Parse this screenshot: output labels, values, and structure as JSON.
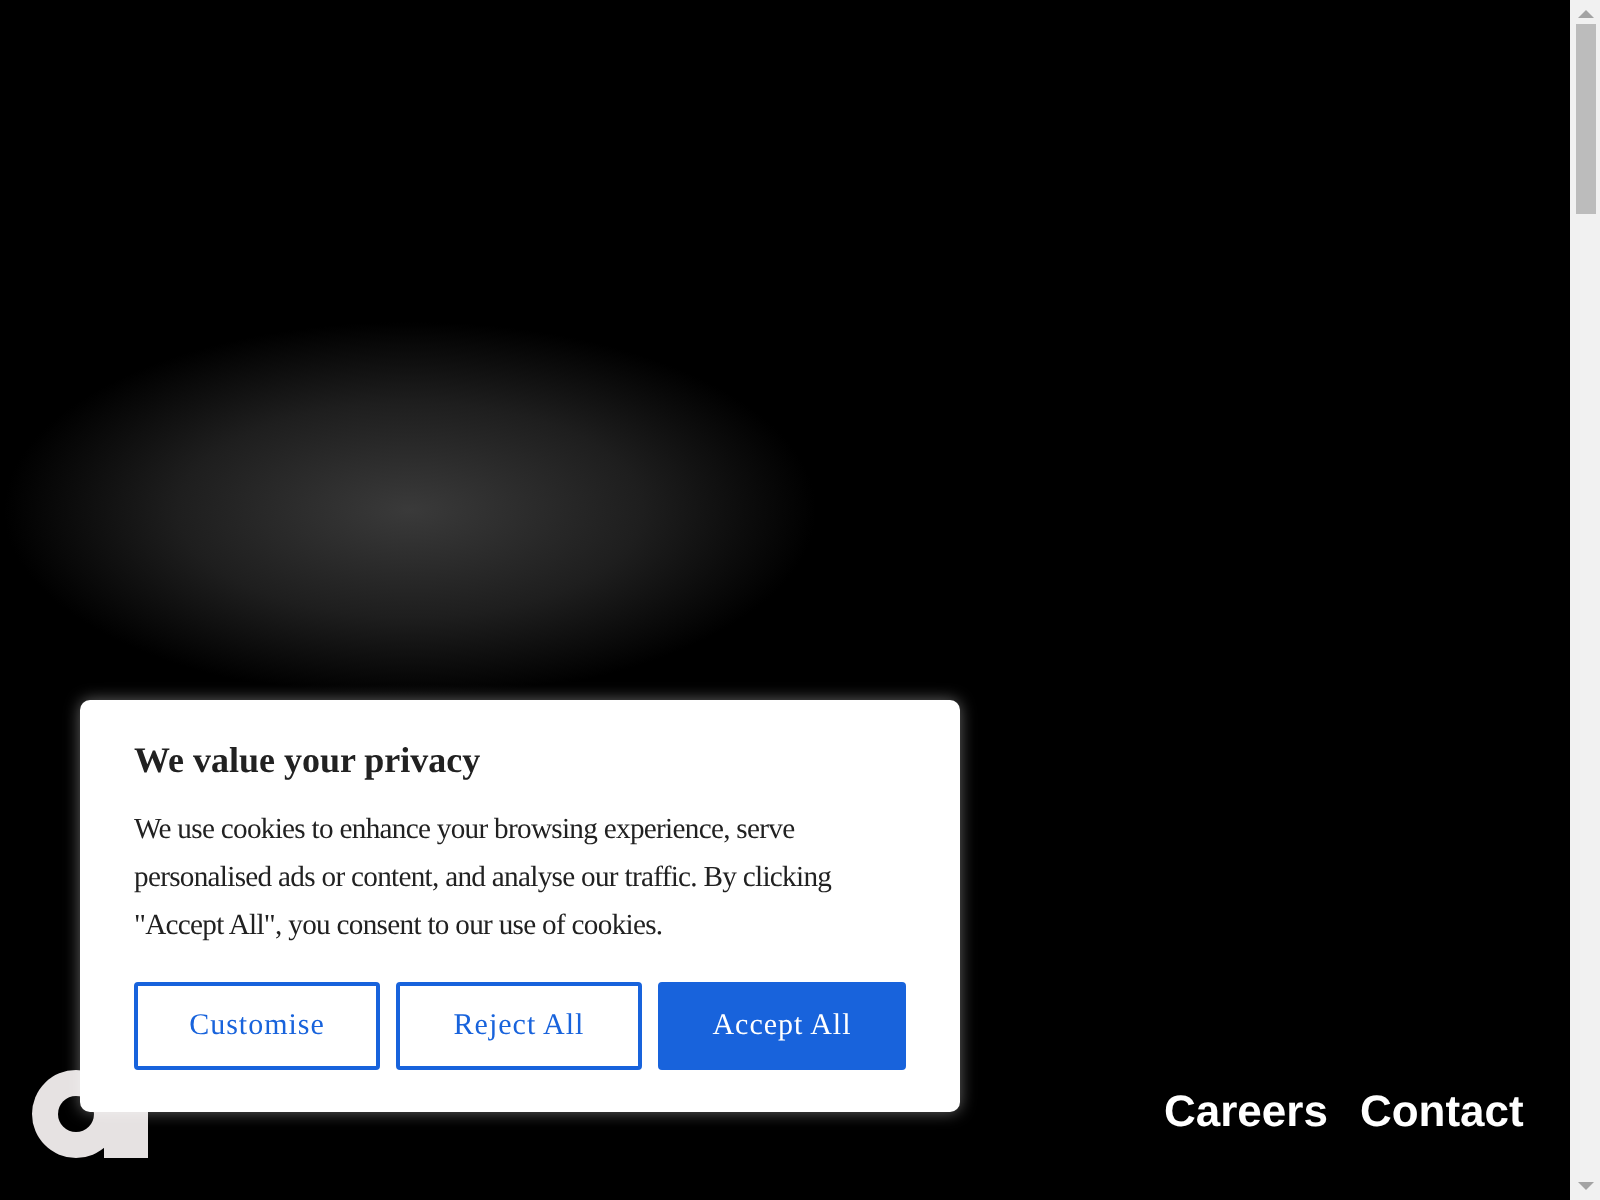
{
  "nav": [
    {
      "label": "Careers",
      "selected": false
    },
    {
      "label": "Contact",
      "selected": false
    }
  ],
  "cookie_dialog": {
    "title": "We value your privacy",
    "text": "We use cookies to enhance your browsing experience, serve personalised ads or content, and analyse our traffic. By clicking \"Accept All\", you consent to our use of cookies.",
    "buttons": [
      {
        "label": "Customise",
        "kind": "outline"
      },
      {
        "label": "Reject All",
        "kind": "outline"
      },
      {
        "label": "Accept All",
        "kind": "primary"
      }
    ]
  }
}
